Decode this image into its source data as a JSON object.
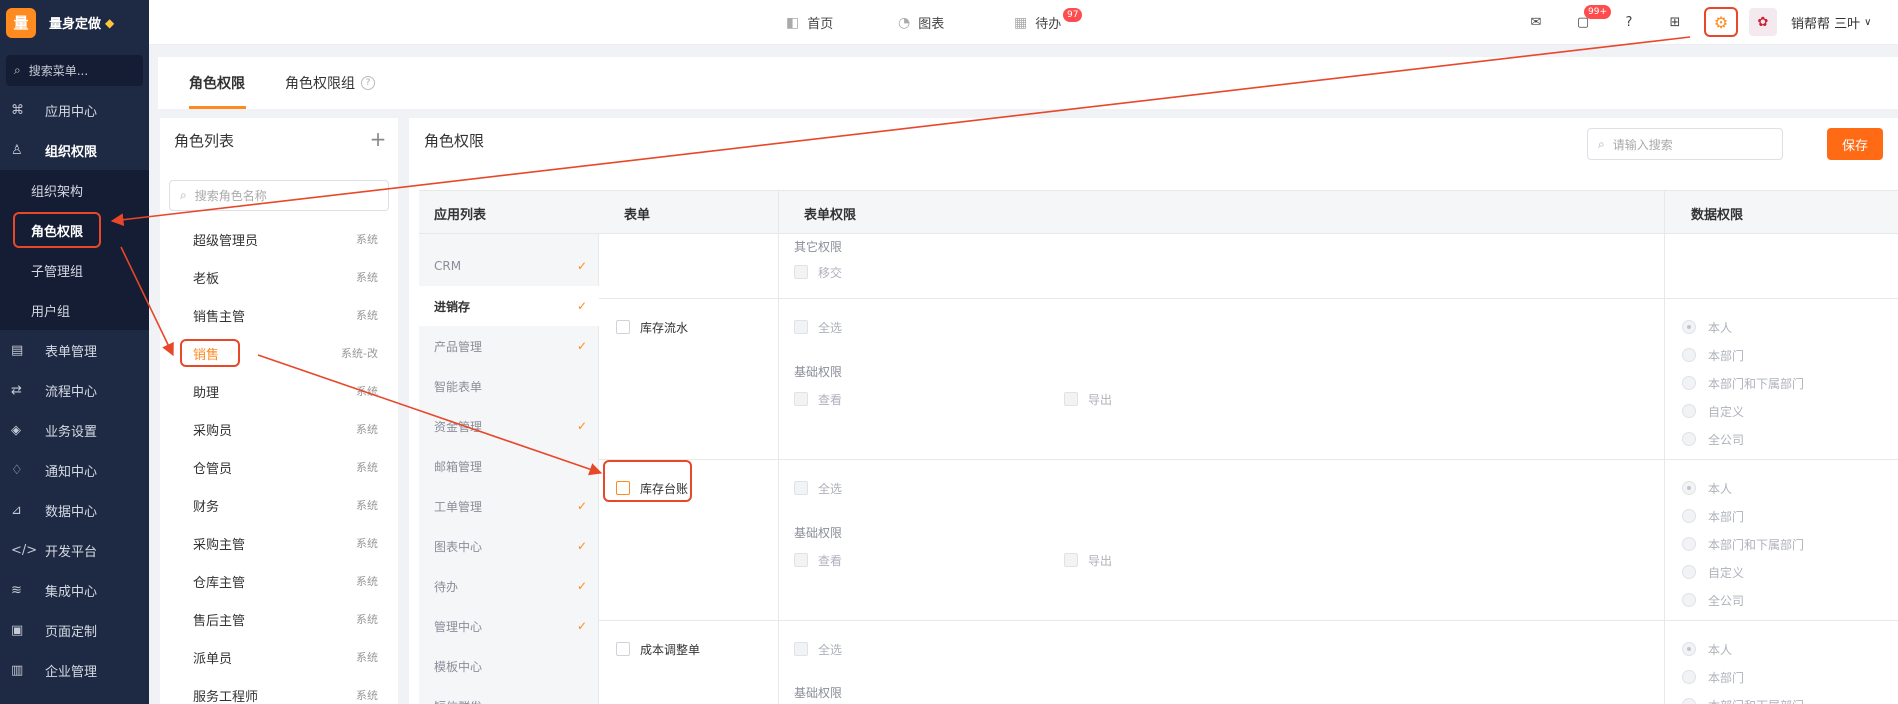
{
  "sidebar": {
    "logo_char": "量",
    "brand": "量身定做",
    "search": "搜索菜单...",
    "items": [
      {
        "label": "应用中心",
        "icon": "apps-icon"
      },
      {
        "label": "组织权限",
        "icon": "user-icon"
      },
      {
        "label": "表单管理",
        "icon": "form-icon"
      },
      {
        "label": "流程中心",
        "icon": "flow-icon"
      },
      {
        "label": "业务设置",
        "icon": "cube-icon"
      },
      {
        "label": "通知中心",
        "icon": "bell-icon"
      },
      {
        "label": "数据中心",
        "icon": "chart-icon"
      },
      {
        "label": "开发平台",
        "icon": "code-icon"
      },
      {
        "label": "集成中心",
        "icon": "layers-icon"
      },
      {
        "label": "页面定制",
        "icon": "page-icon"
      },
      {
        "label": "企业管理",
        "icon": "building-icon"
      }
    ],
    "submenu": [
      "组织架构",
      "角色权限",
      "子管理组",
      "用户组"
    ]
  },
  "topbar": {
    "nav": [
      {
        "label": "首页",
        "icon": "home-icon"
      },
      {
        "label": "图表",
        "icon": "pie-icon"
      },
      {
        "label": "待办",
        "icon": "calendar-icon",
        "badge": "97"
      }
    ],
    "msg_badge": "99+",
    "user": "销帮帮 三叶"
  },
  "tabs": [
    "角色权限",
    "角色权限组"
  ],
  "role_panel": {
    "title": "角色列表",
    "search_placeholder": "搜索角色名称",
    "roles": [
      {
        "name": "超级管理员",
        "tag": "系统"
      },
      {
        "name": "老板",
        "tag": "系统"
      },
      {
        "name": "销售主管",
        "tag": "系统"
      },
      {
        "name": "销售",
        "tag": "系统-改"
      },
      {
        "name": "助理",
        "tag": "系统"
      },
      {
        "name": "采购员",
        "tag": "系统"
      },
      {
        "name": "仓管员",
        "tag": "系统"
      },
      {
        "name": "财务",
        "tag": "系统"
      },
      {
        "name": "采购主管",
        "tag": "系统"
      },
      {
        "name": "仓库主管",
        "tag": "系统"
      },
      {
        "name": "售后主管",
        "tag": "系统"
      },
      {
        "name": "派单员",
        "tag": "系统"
      },
      {
        "name": "服务工程师",
        "tag": "系统"
      }
    ]
  },
  "main": {
    "title": "角色权限",
    "search_placeholder": "请输入搜索",
    "save": "保存",
    "headers": {
      "apps": "应用列表",
      "form": "表单",
      "form_perm": "表单权限",
      "data_perm": "数据权限"
    },
    "apps": [
      {
        "name": "CRM",
        "checked": true
      },
      {
        "name": "进销存",
        "checked": true
      },
      {
        "name": "产品管理",
        "checked": true
      },
      {
        "name": "智能表单",
        "checked": false
      },
      {
        "name": "资金管理",
        "checked": true
      },
      {
        "name": "邮箱管理",
        "checked": false
      },
      {
        "name": "工单管理",
        "checked": true
      },
      {
        "name": "图表中心",
        "checked": true
      },
      {
        "name": "待办",
        "checked": true
      },
      {
        "name": "管理中心",
        "checked": true
      },
      {
        "name": "模板中心",
        "checked": false
      },
      {
        "name": "短信群发",
        "checked": false
      }
    ],
    "other_perm_label": "其它权限",
    "transfer": "移交",
    "select_all": "全选",
    "basic_perm": "基础权限",
    "view": "查看",
    "export": "导出",
    "forms": [
      "库存流水",
      "库存台账",
      "成本调整单"
    ],
    "data_scopes": [
      "本人",
      "本部门",
      "本部门和下属部门",
      "自定义",
      "全公司"
    ]
  }
}
